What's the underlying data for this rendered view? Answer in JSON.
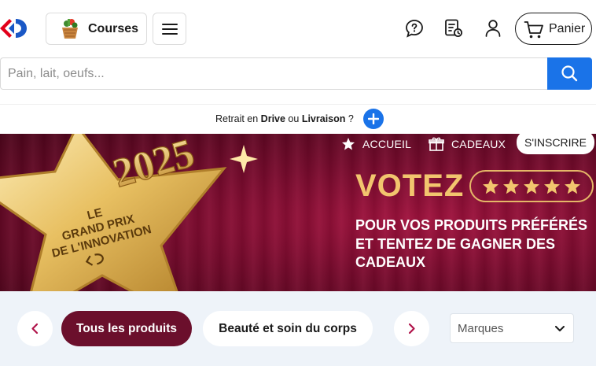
{
  "header": {
    "logo_name": "carrefour-logo",
    "courses_label": "Courses",
    "cart_label": "Panier",
    "icons": [
      "help-chat-icon",
      "shopping-list-icon",
      "user-account-icon",
      "cart-icon"
    ]
  },
  "search": {
    "placeholder": "Pain, lait, oeufs...",
    "value": ""
  },
  "delivery": {
    "prefix": "Retrait en ",
    "drive": "Drive",
    "middle": " ou ",
    "livraison": "Livraison",
    "suffix": " ?"
  },
  "banner": {
    "nav_accueil": "ACCUEIL",
    "nav_cadeaux": "CADEAUX",
    "sinscrire": "S'INSCRIRE",
    "votez": "VOTEZ",
    "star_rating": 5,
    "tagline": "POUR VOS PRODUITS PRÉFÉRÉS ET TENTEZ DE GAGNER DES CADEAUX",
    "year": "2025",
    "star_text_line1": "LE",
    "star_text_line2": "GRAND PRIX",
    "star_text_line3": "DE L'INNOVATION"
  },
  "categories": {
    "items": [
      "Tous les produits",
      "Beauté et soin du corps"
    ],
    "active_index": 0,
    "brand_filter_label": "Marques"
  },
  "colors": {
    "primary_blue": "#1a73e8",
    "burgundy": "#6b0f2c",
    "banner_red": "#7a0b2e",
    "gold": "#f2c56e"
  }
}
